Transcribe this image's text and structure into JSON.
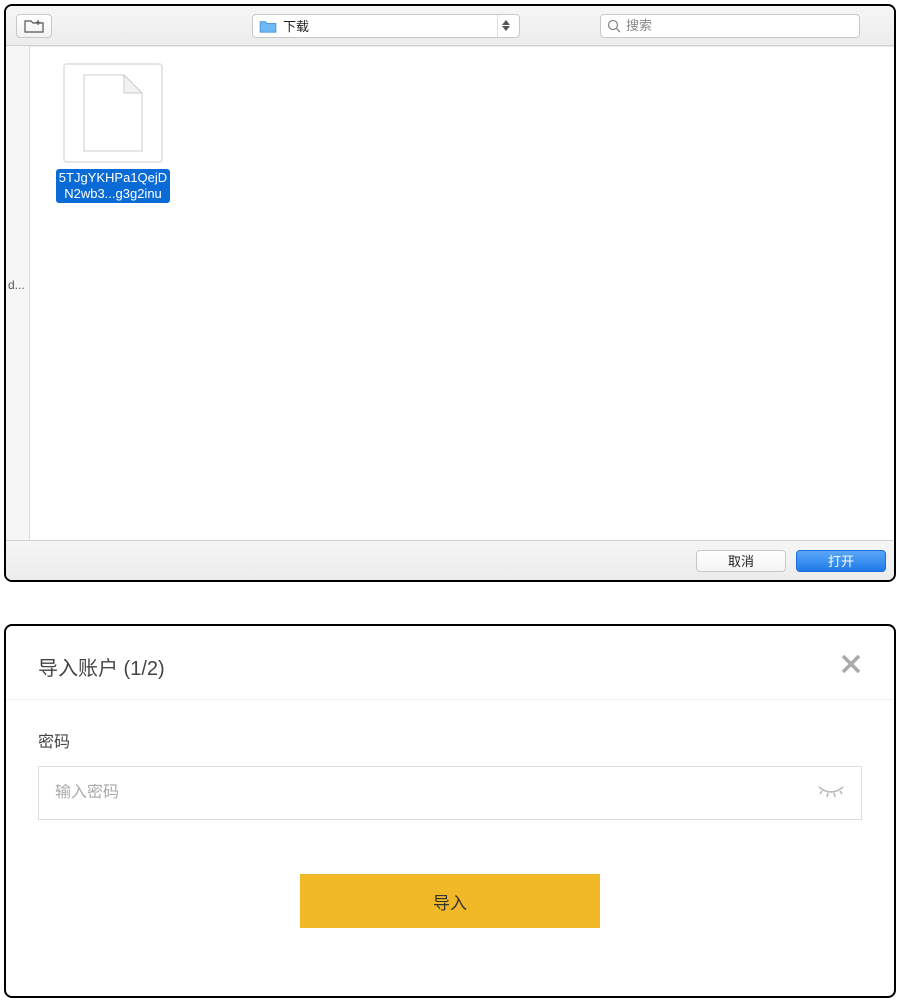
{
  "file_dialog": {
    "location_label": "下载",
    "search_placeholder": "搜索",
    "sidebar_truncated": "d...",
    "selected_file_name": "5TJgYKHPa1QejD\nN2wb3...g3g2inu",
    "cancel_label": "取消",
    "open_label": "打开"
  },
  "import_dialog": {
    "title": "导入账户 (1/2)",
    "password_label": "密码",
    "password_placeholder": "输入密码",
    "submit_label": "导入"
  }
}
